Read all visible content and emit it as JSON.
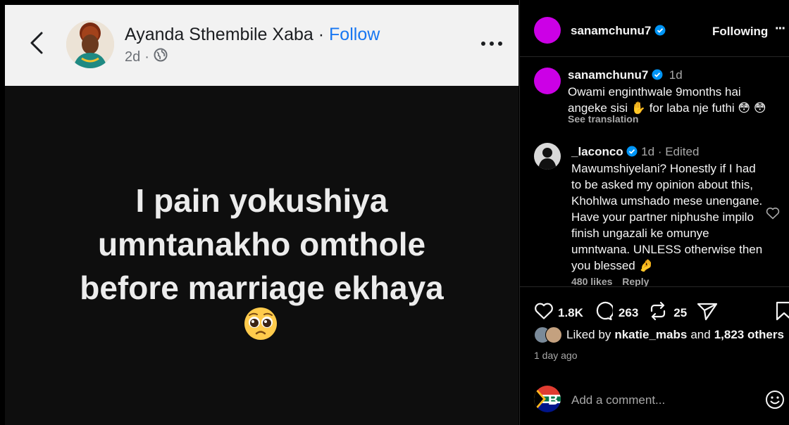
{
  "facebook_post": {
    "author_name": "Ayanda Sthembile Xaba",
    "separator": "·",
    "follow_label": "Follow",
    "time": "2d",
    "dot": "·",
    "body_lines": [
      "I pain yokushiya",
      "umntanakho omthole",
      "before marriage ekhaya"
    ]
  },
  "instagram": {
    "header": {
      "username": "sanamchunu7",
      "following_label": "Following",
      "more_label": "···"
    },
    "caption": {
      "username": "sanamchunu7",
      "time": "1d",
      "line1": "Owami enginthwale 9months hai",
      "line2": "angeke sisi",
      "line2b": "for laba nje futhi",
      "see_translation": "See translation"
    },
    "comment": {
      "username": "_laconco",
      "time": "1d",
      "edited": "· Edited",
      "lines": [
        "Mawumshiyelani? Honestly if I had",
        "to be asked my opinion about this,",
        "Khohlwa umshado mese unengane.",
        "Have your partner niphushe impilo",
        "finish ungazali ke omunye",
        "umntwana. UNLESS otherwise then",
        "you blessed"
      ],
      "likes": "480 likes",
      "reply_label": "Reply"
    },
    "actions": {
      "likes_count": "1.8K",
      "comments_count": "263",
      "reposts_count": "25"
    },
    "liked_by": {
      "prefix": "Liked by",
      "user": "nkatie_mabs",
      "and": "and",
      "others": "1,823 others"
    },
    "timestamp": "1 day ago",
    "add_comment_placeholder": "Add a comment..."
  },
  "colors": {
    "accent_blue": "#1877f2",
    "verified_blue": "#0095f6",
    "avatar_purple": "#cc00e6"
  }
}
